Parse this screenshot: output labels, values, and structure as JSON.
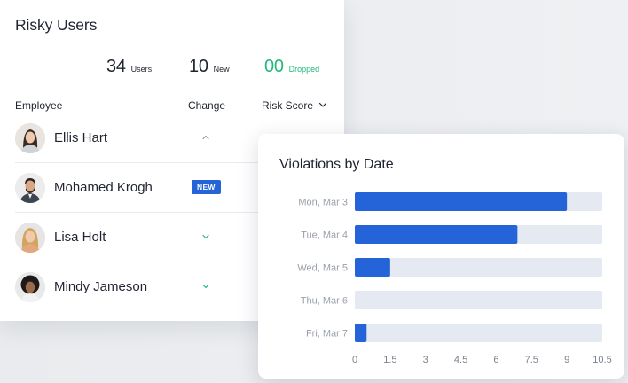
{
  "users_card": {
    "title": "Risky Users",
    "stats": [
      {
        "value": "34",
        "label": "Users"
      },
      {
        "value": "10",
        "label": "New"
      },
      {
        "value": "00",
        "label": "Dropped",
        "color": "#20b97b"
      }
    ],
    "columns": {
      "employee": "Employee",
      "change": "Change",
      "risk_score": "Risk Score"
    },
    "rows": [
      {
        "name": "Ellis Hart",
        "change": "chevron-up-icon"
      },
      {
        "name": "Mohamed Krogh",
        "change": "new-badge",
        "badge": "NEW"
      },
      {
        "name": "Lisa Holt",
        "change": "chevron-down-icon"
      },
      {
        "name": "Mindy Jameson",
        "change": "chevron-down-icon"
      }
    ],
    "colors": {
      "badge": "#2563d9",
      "chevron": "#20b97b"
    }
  },
  "chart_card": {
    "title": "Violations by Date"
  },
  "chart_data": {
    "type": "bar",
    "orientation": "horizontal",
    "title": "Violations by Date",
    "categories": [
      "Mon, Mar 3",
      "Tue, Mar 4",
      "Wed, Mar 5",
      "Thu, Mar 6",
      "Fri, Mar 7"
    ],
    "values": [
      9,
      6.9,
      1.5,
      0,
      0.5
    ],
    "xlim": [
      0,
      10.5
    ],
    "xticks": [
      "0",
      "1.5",
      "3",
      "4.5",
      "6",
      "7.5",
      "9",
      "10.5"
    ],
    "grid": false,
    "colors": {
      "bar": "#2563d9",
      "track": "#e4e9f2"
    }
  }
}
